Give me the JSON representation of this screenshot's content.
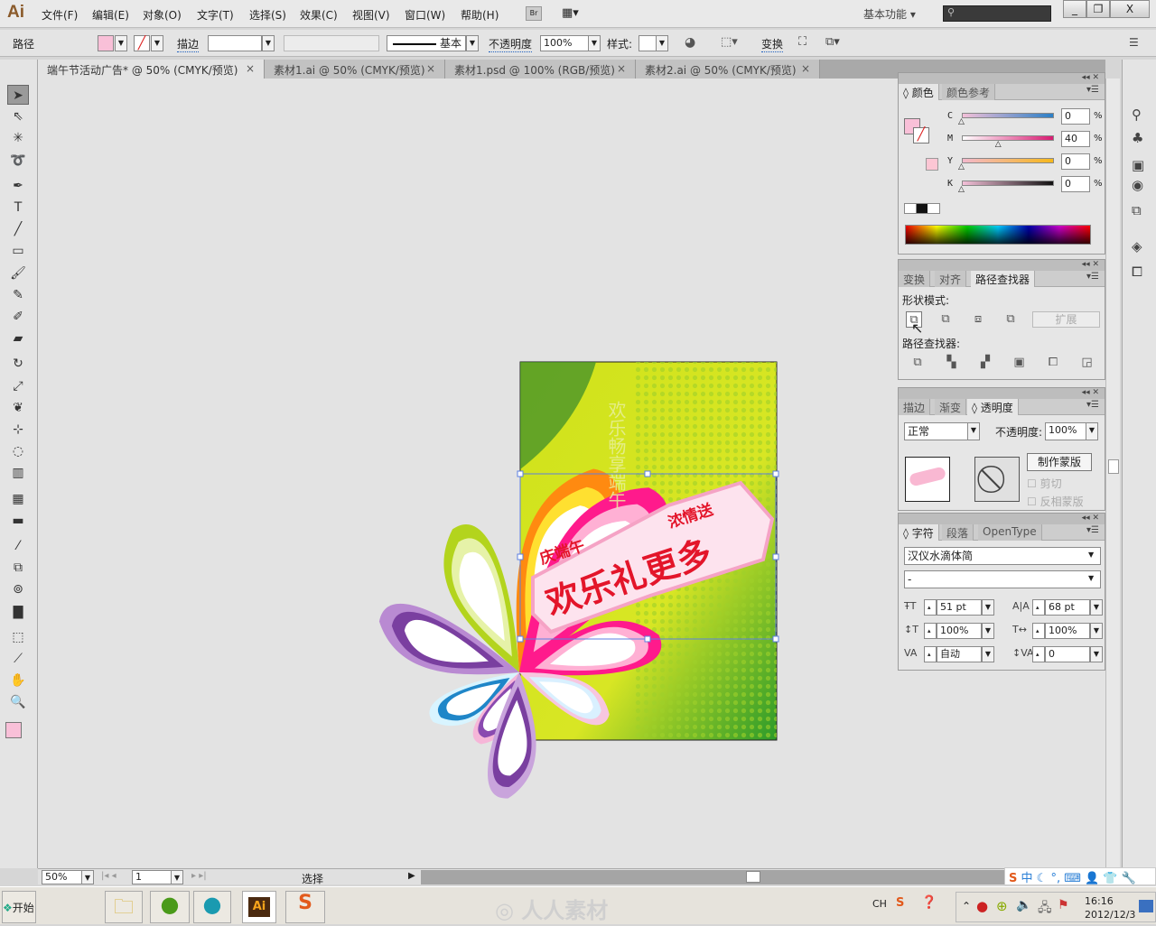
{
  "app": {
    "logo": "Ai",
    "menu": [
      "文件(F)",
      "编辑(E)",
      "对象(O)",
      "文字(T)",
      "选择(S)",
      "效果(C)",
      "视图(V)",
      "窗口(W)",
      "帮助(H)"
    ],
    "bridge": "Br",
    "workspace": "基本功能",
    "search_placeholder": "",
    "window_controls": {
      "minimize": "_",
      "restore": "❐",
      "close": "X"
    }
  },
  "control": {
    "selection_type": "路径",
    "fill_color": "#f9c0d8",
    "stroke_label": "描边",
    "stroke_value": "",
    "stroke_profile": "基本",
    "opacity_label": "不透明度",
    "opacity_value": "100%",
    "style_label": "样式",
    "transform_label": "变换"
  },
  "tabs": [
    {
      "label": "端午节活动广告* @ 50% (CMYK/预览)",
      "active": true
    },
    {
      "label": "素材1.ai @ 50% (CMYK/预览)"
    },
    {
      "label": "素材1.psd @ 100% (RGB/预览)"
    },
    {
      "label": "素材2.ai @ 50% (CMYK/预览)"
    }
  ],
  "tab_close": "×",
  "tools": [
    "selection-tool",
    "direct-selection-tool",
    "magic-wand-tool",
    "lasso-tool",
    "pen-tool",
    "type-tool",
    "line-tool",
    "rectangle-tool",
    "paintbrush-tool",
    "pencil-tool",
    "blob-brush-tool",
    "eraser-tool",
    "rotate-tool",
    "scale-tool",
    "warp-tool",
    "free-transform-tool",
    "shape-builder-tool",
    "perspective-grid-tool",
    "mesh-tool",
    "gradient-tool",
    "eyedropper-tool",
    "blend-tool",
    "symbol-sprayer-tool",
    "column-graph-tool",
    "artboard-tool",
    "slice-tool",
    "hand-tool",
    "zoom-tool"
  ],
  "color_panel": {
    "tabs": [
      "颜色",
      "颜色参考"
    ],
    "channels": [
      {
        "name": "C",
        "value": "0",
        "unit": "%"
      },
      {
        "name": "M",
        "value": "40",
        "unit": "%"
      },
      {
        "name": "Y",
        "value": "0",
        "unit": "%"
      },
      {
        "name": "K",
        "value": "0",
        "unit": "%"
      }
    ],
    "fill": "#f9c0d8"
  },
  "pathfinder_panel": {
    "tabs": [
      "变换",
      "对齐",
      "路径查找器"
    ],
    "shape_modes_label": "形状模式:",
    "expand_button": "扩展",
    "pathfinders_label": "路径查找器:"
  },
  "transparency_panel": {
    "tabs": [
      "描边",
      "渐变",
      "透明度"
    ],
    "blend_mode": "正常",
    "opacity_label": "不透明度:",
    "opacity_value": "100%",
    "make_mask_button": "制作蒙版",
    "clip_label": "剪切",
    "invert_mask_label": "反相蒙版"
  },
  "character_panel": {
    "tabs": [
      "字符",
      "段落",
      "OpenType"
    ],
    "font_family": "汉仪水滴体简",
    "font_style": "-",
    "font_size": "51 pt",
    "leading": "68 pt",
    "vertical_scale": "100%",
    "horizontal_scale": "100%",
    "kerning": "自动",
    "tracking": "0"
  },
  "artwork": {
    "headline": "欢乐礼更多",
    "sub_left": "庆端午",
    "sub_right": "浓情送",
    "bg_text": "欢乐畅享端午"
  },
  "status": {
    "zoom": "50%",
    "artboard": "1",
    "tool_label": "选择"
  },
  "taskbar": {
    "start": "开始",
    "tray_lang": "CH",
    "ime_mode": "中",
    "time": "16:16",
    "date": "2012/12/3",
    "watermark": "人人素材"
  }
}
